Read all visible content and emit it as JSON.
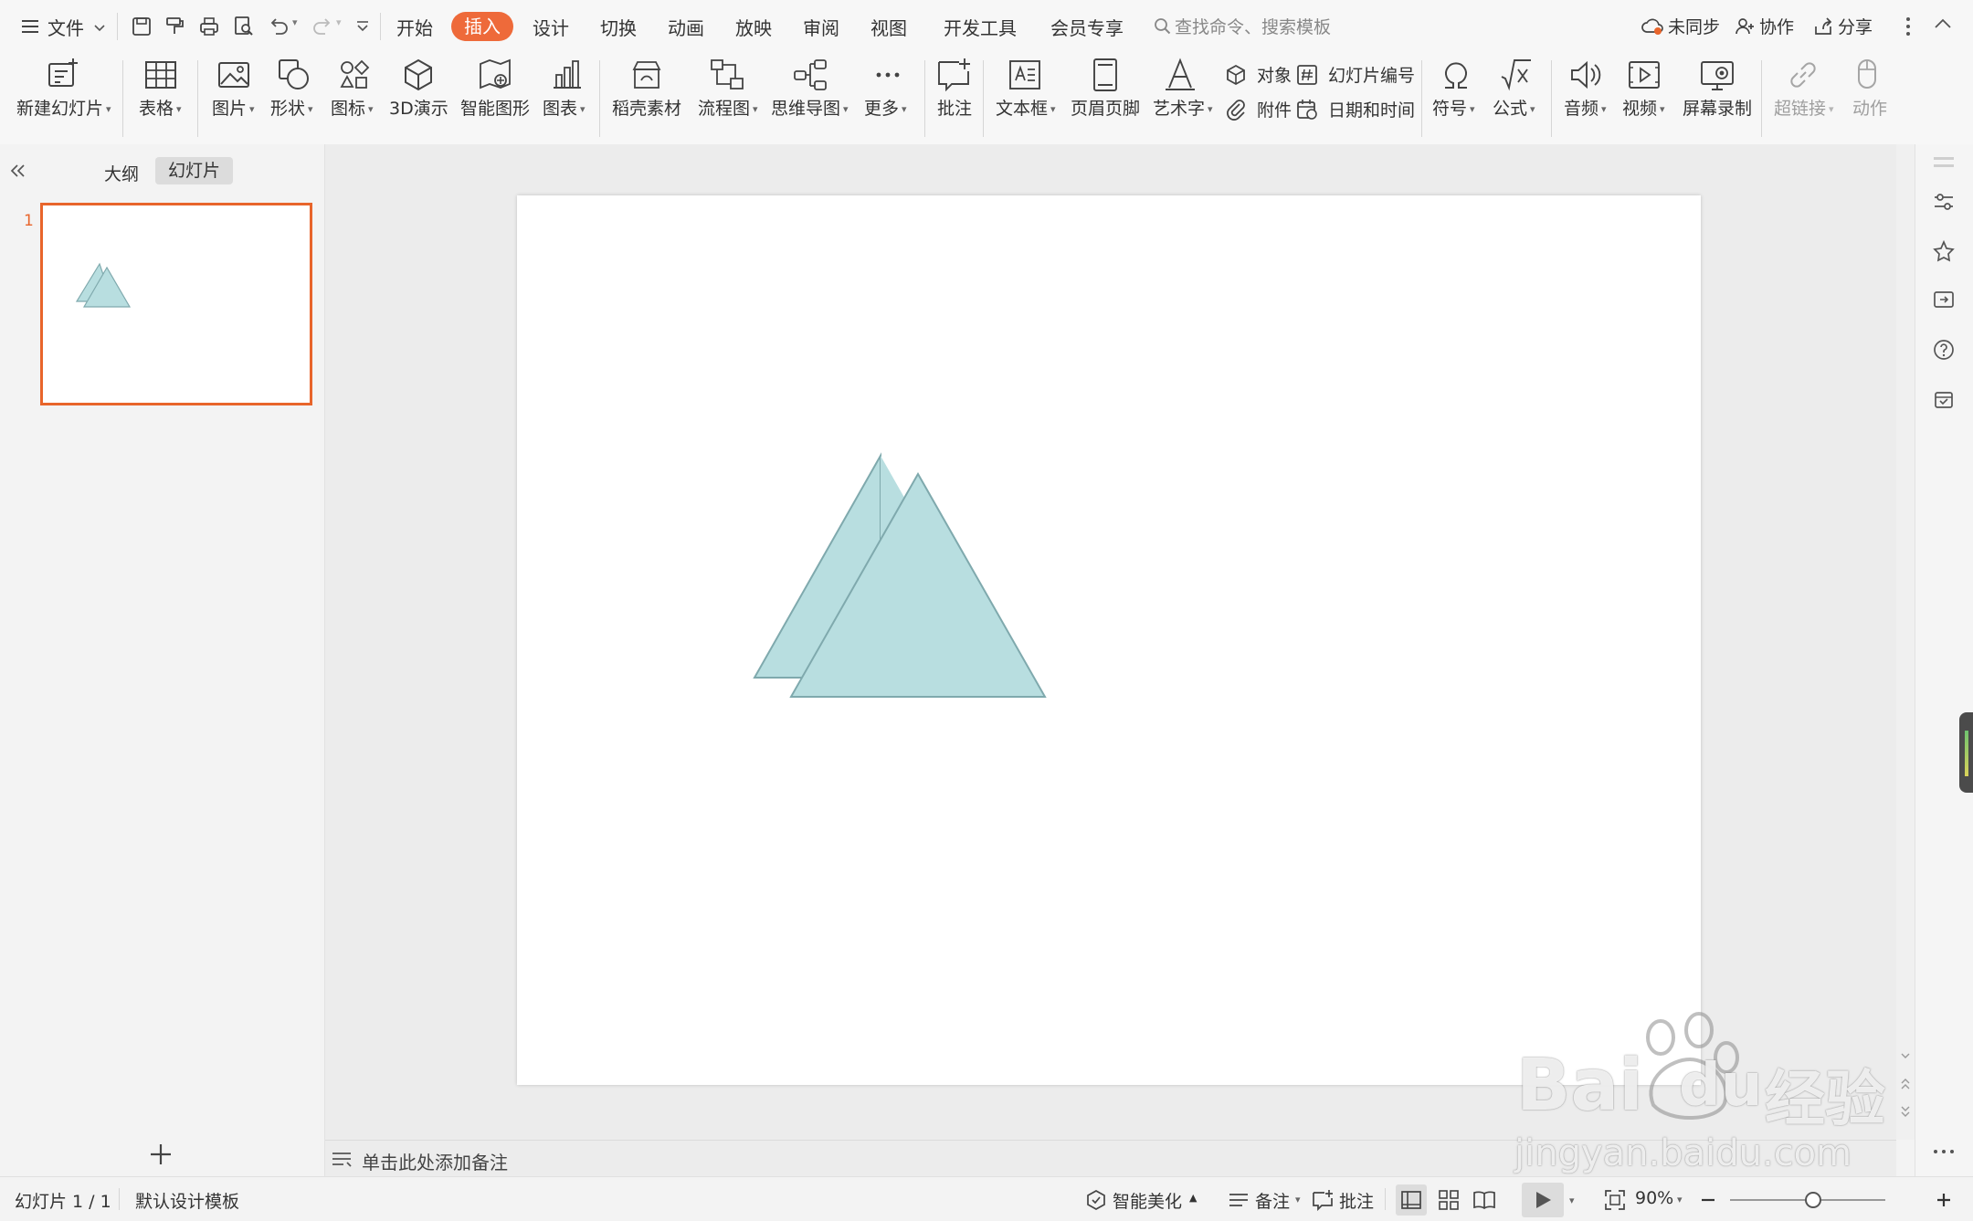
{
  "menubar": {
    "file_label": "文件",
    "tabs": [
      "开始",
      "插入",
      "设计",
      "切换",
      "动画",
      "放映",
      "审阅",
      "视图",
      "开发工具",
      "会员专享"
    ],
    "active_tab": "插入",
    "search_placeholder": "查找命令、搜索模板",
    "sync_label": "未同步",
    "collab_label": "协作",
    "share_label": "分享"
  },
  "ribbon": {
    "new_slide": "新建幻灯片",
    "table": "表格",
    "picture": "图片",
    "shape": "形状",
    "icon": "图标",
    "demo3d": "3D演示",
    "smartart": "智能图形",
    "chart": "图表",
    "material": "稻壳素材",
    "flowchart": "流程图",
    "mindmap": "思维导图",
    "more": "更多",
    "comment": "批注",
    "textbox": "文本框",
    "header_footer": "页眉页脚",
    "wordart": "艺术字",
    "object": "对象",
    "attachment": "附件",
    "slide_number": "幻灯片编号",
    "datetime": "日期和时间",
    "symbol": "符号",
    "formula": "公式",
    "audio": "音频",
    "video": "视频",
    "screen_record": "屏幕录制",
    "hyperlink": "超链接",
    "action": "动作"
  },
  "leftpanel": {
    "outline_tab": "大纲",
    "slides_tab": "幻灯片",
    "slide_index": "1"
  },
  "notes": {
    "placeholder": "单击此处添加备注"
  },
  "statusbar": {
    "slide_count": "幻灯片 1 / 1",
    "template": "默认设计模板",
    "beautify": "智能美化",
    "notes": "备注",
    "comment": "批注",
    "zoom": "90%"
  },
  "watermark": {
    "brand": "Bai",
    "brand_tail": "du",
    "cn": "经验",
    "url": "jingyan.baidu.com"
  },
  "colors": {
    "accent": "#ee6a3a",
    "thumb_border": "#e8652b",
    "triangle_fill": "#b8dee0",
    "triangle_stroke": "#7fa9ad"
  }
}
